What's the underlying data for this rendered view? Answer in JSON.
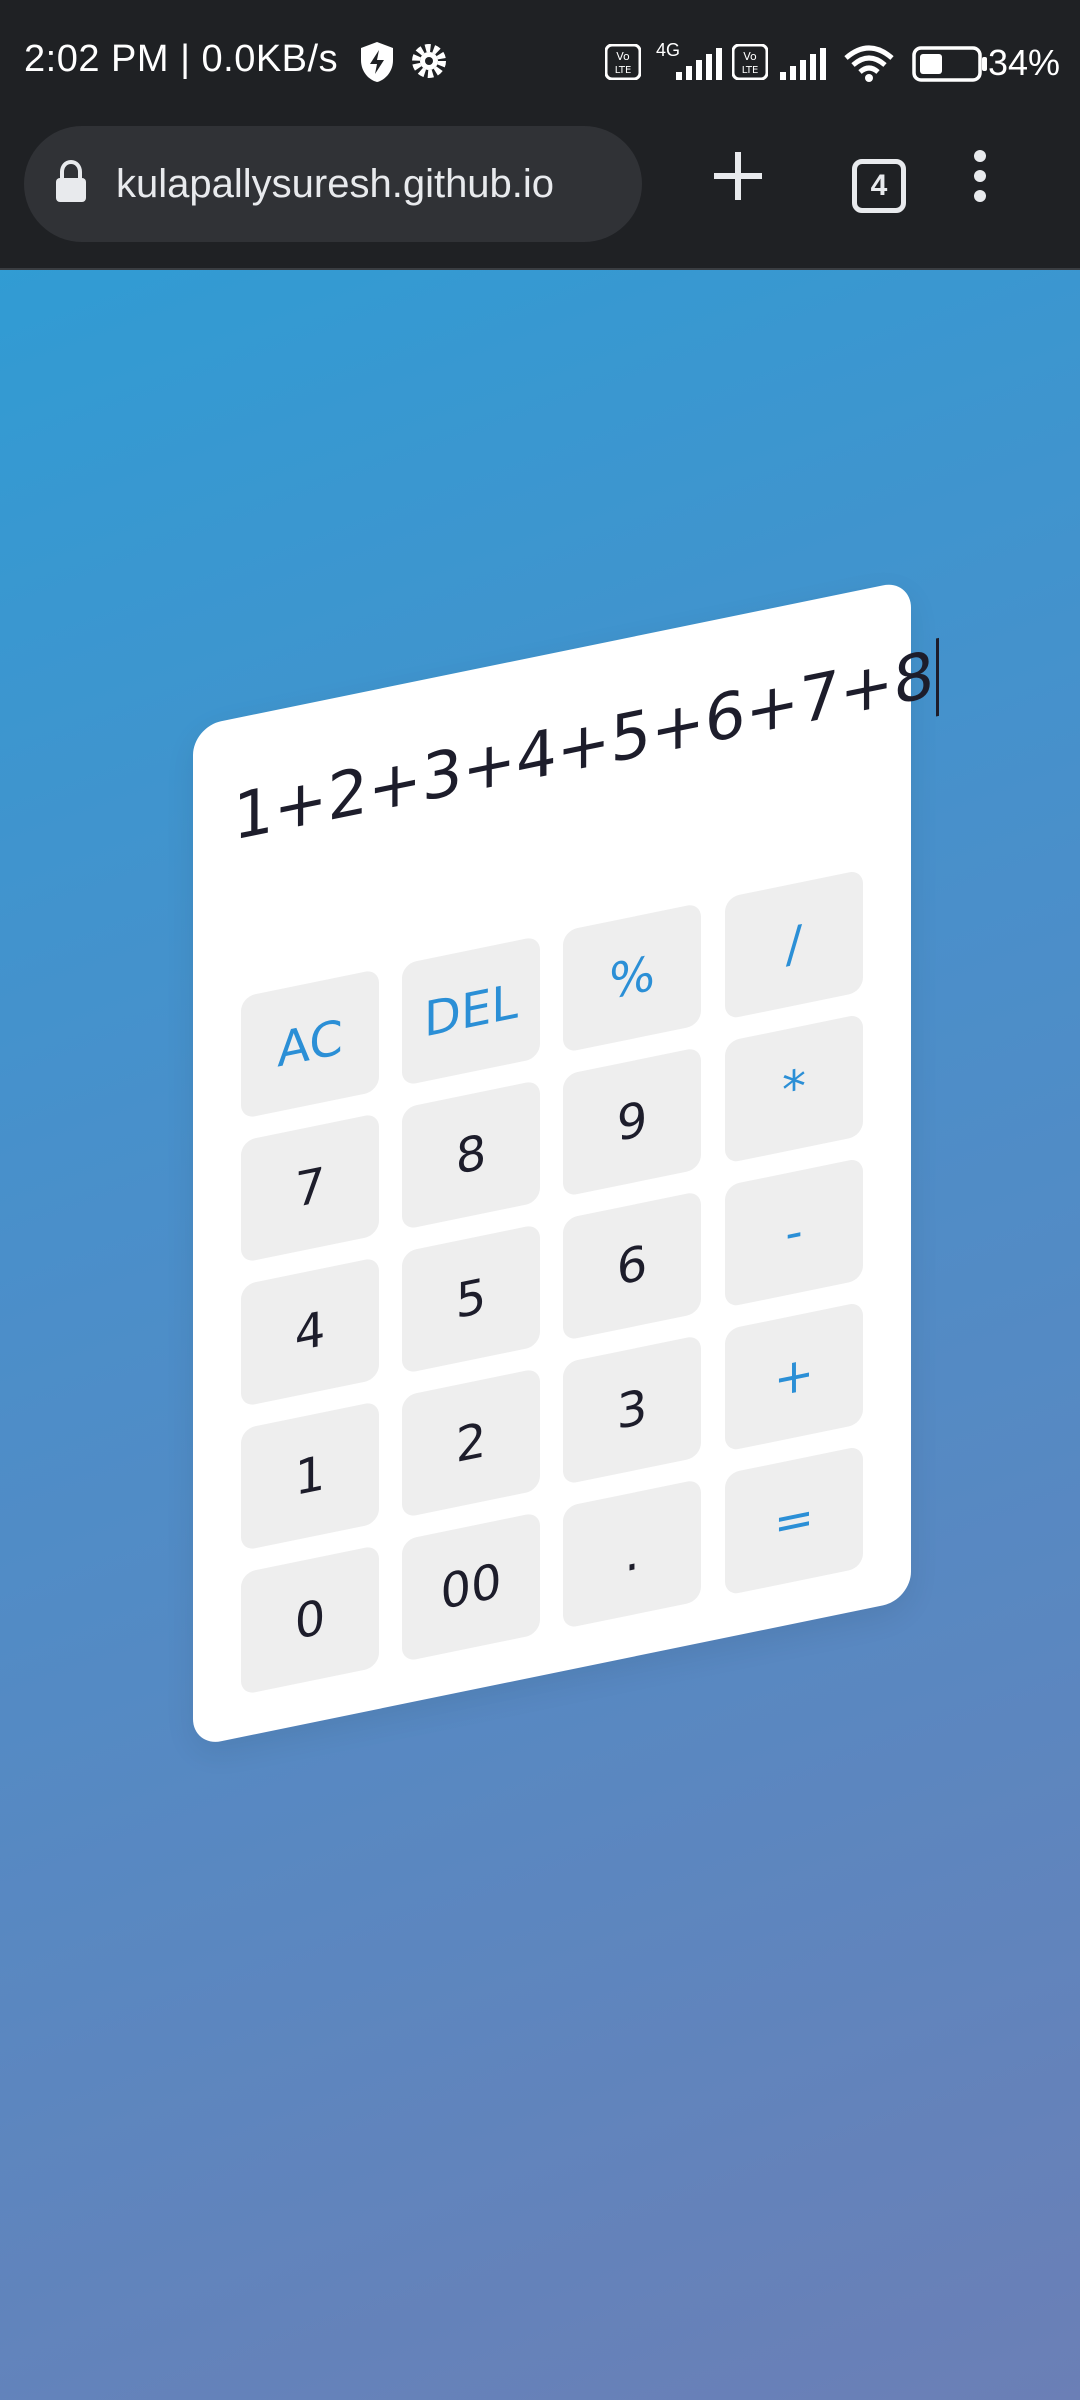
{
  "status_bar": {
    "time_speed": "2:02 PM | 0.0KB/s",
    "network": "4G",
    "battery": "34%"
  },
  "browser": {
    "url": "kulapallysuresh.github.io",
    "tab_count": "4"
  },
  "calculator": {
    "display": "1+2+3+4+5+6+7+8",
    "keys": {
      "ac": "AC",
      "del": "DEL",
      "percent": "%",
      "divide": "/",
      "seven": "7",
      "eight": "8",
      "nine": "9",
      "multiply": "*",
      "four": "4",
      "five": "5",
      "six": "6",
      "minus": "-",
      "one": "1",
      "two": "2",
      "three": "3",
      "plus": "+",
      "zero": "0",
      "double_zero": "00",
      "dot": ".",
      "equals": "="
    },
    "accent_color": "#2b8fd6",
    "key_bg": "#eeeeee"
  }
}
